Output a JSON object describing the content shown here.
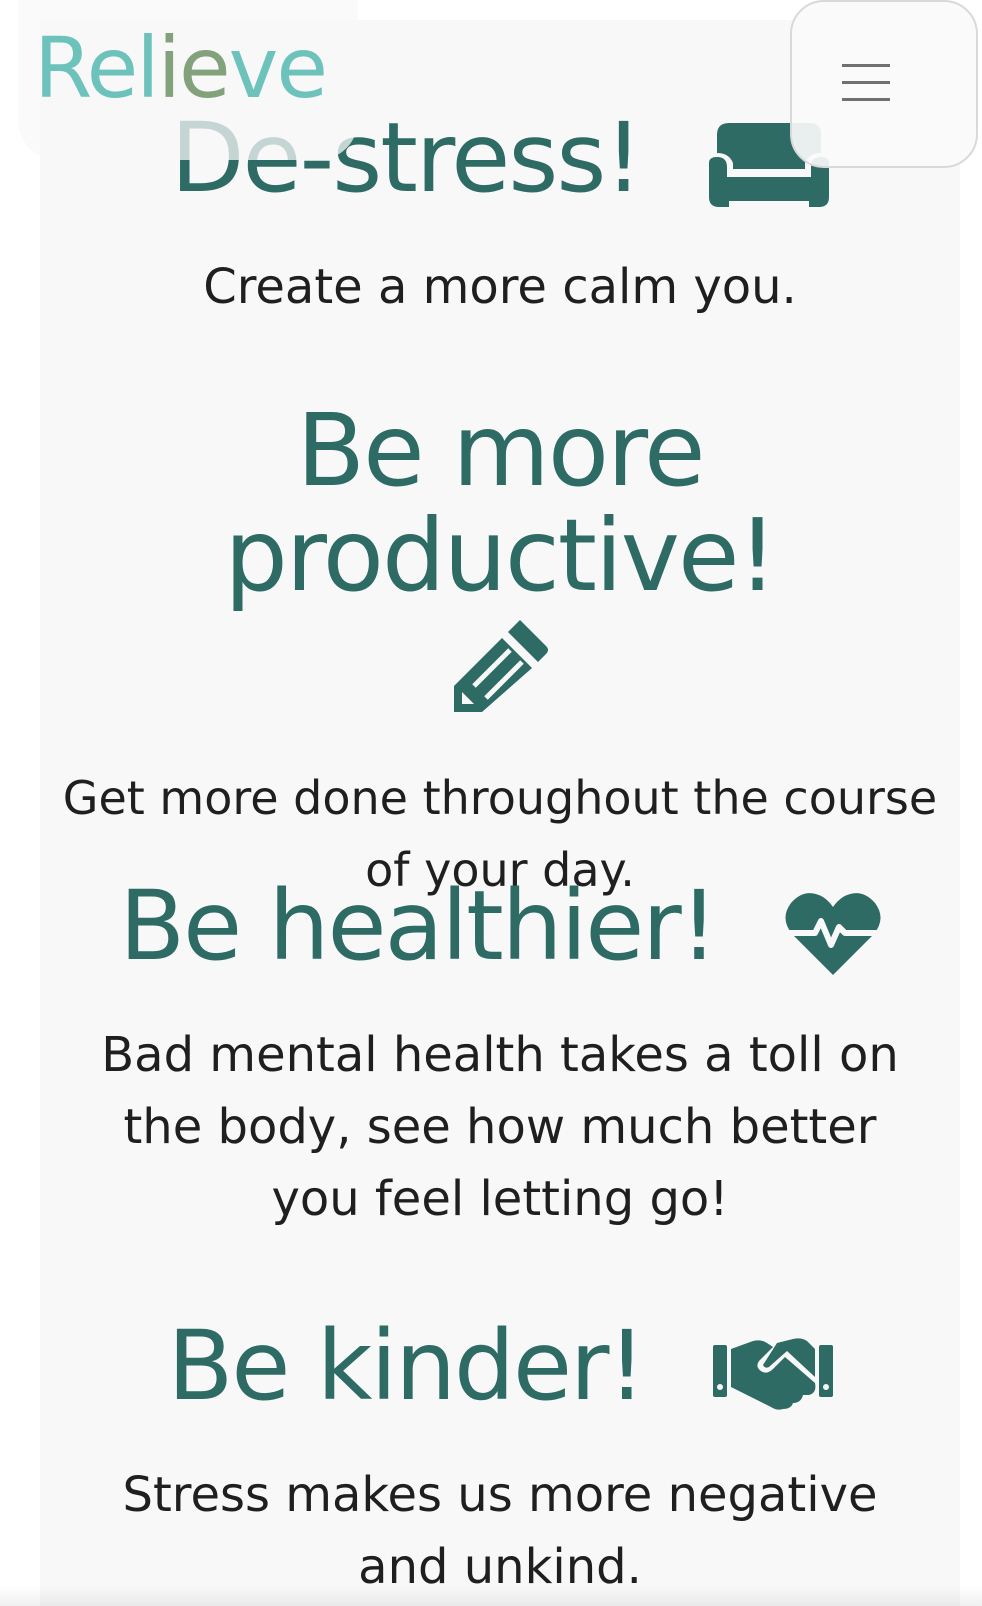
{
  "header": {
    "brand": "Relieve",
    "menu_icon": "hamburger-menu-icon"
  },
  "sections": [
    {
      "title": "De-stress!",
      "icon": "couch-icon",
      "text": "Create a more calm you."
    },
    {
      "title": "Be more productive!",
      "icon": "pencil-icon",
      "text": "Get more done throughout the course of your day."
    },
    {
      "title": "Be healthier!",
      "icon": "heartbeat-icon",
      "text": "Bad mental health takes a toll on the body, see how much better you feel letting go!"
    },
    {
      "title": "Be kinder!",
      "icon": "handshake-icon",
      "text": "Stress makes us more negative and unkind."
    }
  ],
  "colors": {
    "accent": "#2d6b64",
    "brand": "#6dc3bb",
    "brand_mid": "#83a17a",
    "text": "#1f1f1f",
    "panel": "#f8f8f8"
  }
}
